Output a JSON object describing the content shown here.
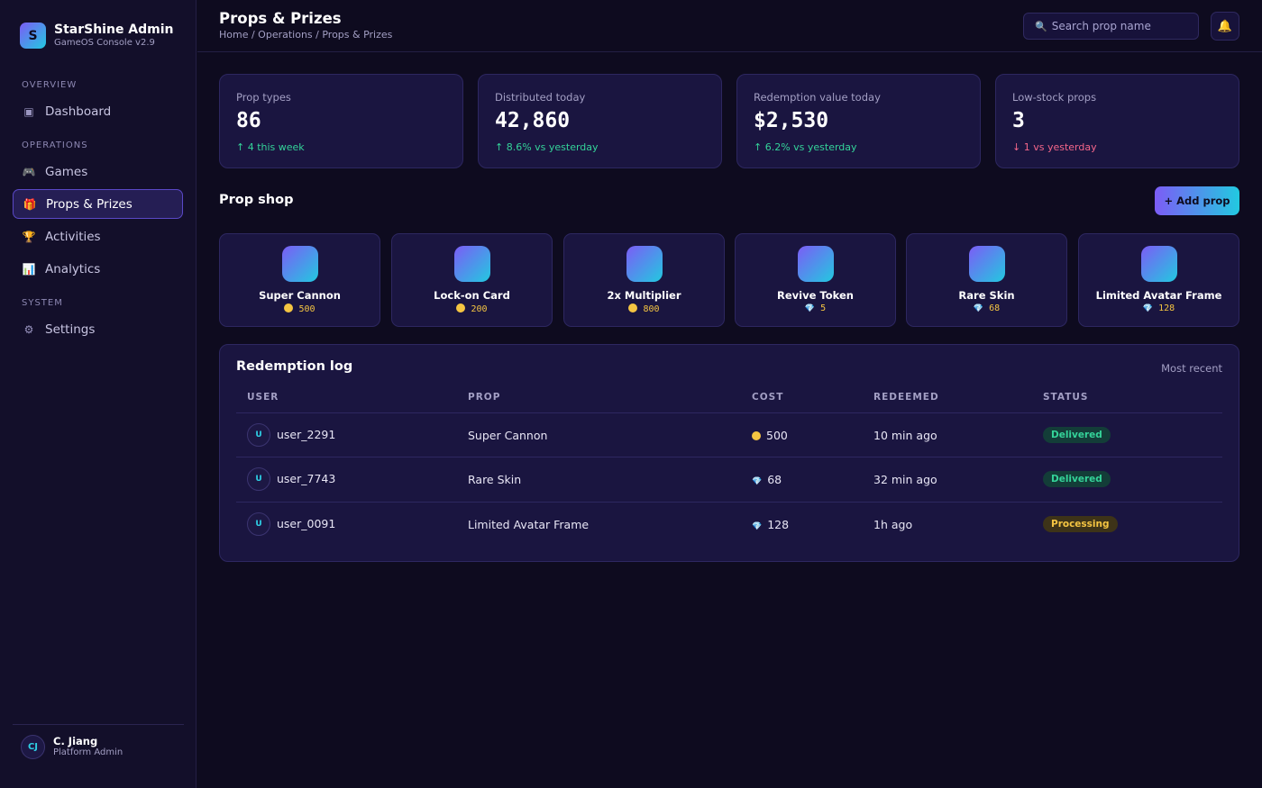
{
  "brand": {
    "initial": "S",
    "name": "StarShine Admin",
    "subtitle": "GameOS Console v2.9"
  },
  "sidebar": {
    "sections": [
      {
        "label": "OVERVIEW"
      },
      {
        "label": "OPERATIONS"
      },
      {
        "label": "SYSTEM"
      }
    ],
    "items": [
      {
        "label": "Dashboard",
        "icon": "dashboard-icon"
      },
      {
        "label": "Games",
        "icon": "gamepad-icon"
      },
      {
        "label": "Props & Prizes",
        "icon": "gift-icon",
        "active": true
      },
      {
        "label": "Activities",
        "icon": "trophy-icon"
      },
      {
        "label": "Analytics",
        "icon": "chart-icon"
      },
      {
        "label": "Settings",
        "icon": "gear-icon"
      }
    ],
    "user": {
      "initials": "CJ",
      "name": "C. Jiang",
      "role": "Platform Admin"
    }
  },
  "header": {
    "title": "Props & Prizes",
    "breadcrumb": "Home / Operations / Props & Prizes",
    "search_placeholder": "Search prop name"
  },
  "stats": [
    {
      "label": "Prop types",
      "value": "86",
      "delta": "↑ 4 this week",
      "trend": "up"
    },
    {
      "label": "Distributed today",
      "value": "42,860",
      "delta": "↑ 8.6% vs yesterday",
      "trend": "up"
    },
    {
      "label": "Redemption value today",
      "value": "$2,530",
      "delta": "↑ 6.2% vs yesterday",
      "trend": "up"
    },
    {
      "label": "Low-stock props",
      "value": "3",
      "delta": "↓ 1 vs yesterday",
      "trend": "down"
    }
  ],
  "prop_shop": {
    "title": "Prop shop",
    "add_label": "+ Add prop",
    "props": [
      {
        "name": "Super Cannon",
        "currency": "coin",
        "price": "500"
      },
      {
        "name": "Lock-on Card",
        "currency": "coin",
        "price": "200"
      },
      {
        "name": "2x Multiplier",
        "currency": "coin",
        "price": "800"
      },
      {
        "name": "Revive Token",
        "currency": "gem",
        "price": "5"
      },
      {
        "name": "Rare Skin",
        "currency": "gem",
        "price": "68"
      },
      {
        "name": "Limited Avatar Frame",
        "currency": "gem",
        "price": "128"
      }
    ]
  },
  "redemption_log": {
    "title": "Redemption log",
    "note": "Most recent",
    "columns": [
      "USER",
      "PROP",
      "COST",
      "REDEEMED",
      "STATUS"
    ],
    "rows": [
      {
        "avatar": "U",
        "user": "user_2291",
        "prop": "Super Cannon",
        "currency": "coin",
        "cost": "500",
        "redeemed": "10 min ago",
        "status": "Delivered"
      },
      {
        "avatar": "U",
        "user": "user_7743",
        "prop": "Rare Skin",
        "currency": "gem",
        "cost": "68",
        "redeemed": "32 min ago",
        "status": "Delivered"
      },
      {
        "avatar": "U",
        "user": "user_0091",
        "prop": "Limited Avatar Frame",
        "currency": "gem",
        "cost": "128",
        "redeemed": "1h ago",
        "status": "Processing"
      }
    ]
  },
  "colors": {
    "accent_start": "#7c5cf6",
    "accent_end": "#22c9e0",
    "positive": "#34d399",
    "negative": "#f4668a",
    "coin": "#f5c542"
  }
}
